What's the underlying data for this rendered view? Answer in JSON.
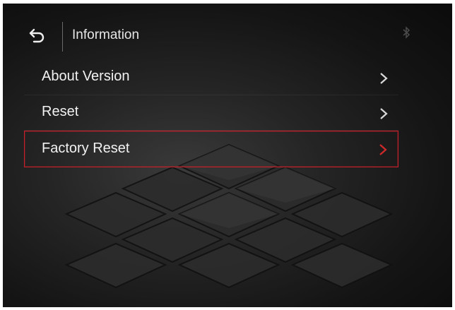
{
  "header": {
    "title": "Information"
  },
  "menu": {
    "items": [
      {
        "label": "About Version",
        "icon": "chevron-right-icon"
      },
      {
        "label": "Reset",
        "icon": "chevron-right-icon"
      },
      {
        "label": "Factory Reset",
        "icon": "chevron-right-icon",
        "selected": true
      }
    ]
  },
  "colors": {
    "text": "#f2f2f2",
    "selection_border": "#c8202a",
    "chevron_default": "#d9d9d9",
    "chevron_selected": "#d02a2a",
    "background": "#1a1a1a"
  },
  "icons": {
    "back": "back-arrow-icon",
    "status": "bluetooth-icon"
  }
}
